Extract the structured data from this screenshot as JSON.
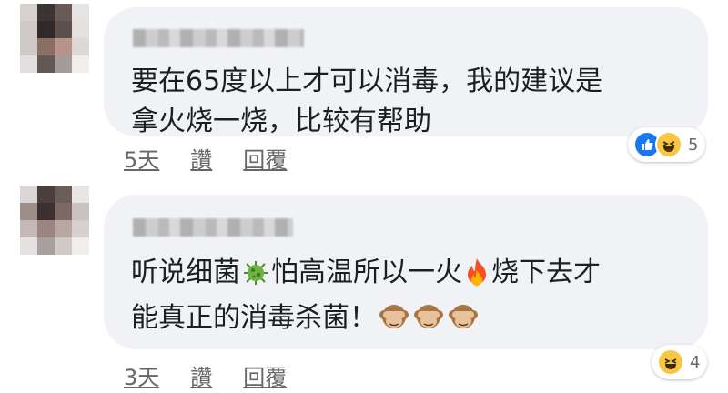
{
  "comments": [
    {
      "text": "要在65度以上才可以消毒，我的建议是\n拿火烧一烧，比较有帮助",
      "time": "5天",
      "like_label": "讚",
      "reply_label": "回覆",
      "reaction_icons": [
        "like-icon",
        "haha-icon"
      ],
      "reaction_count": "5"
    },
    {
      "text_parts": [
        "听说细菌",
        "怕高温所以一火",
        "烧下去才\n能真正的消毒杀菌！"
      ],
      "inline_emojis": [
        "microbe-emoji",
        "fire-emoji",
        "see-no-evil-monkey-emoji"
      ],
      "time": "3天",
      "like_label": "讚",
      "reply_label": "回覆",
      "reaction_icons": [
        "haha-icon"
      ],
      "reaction_count": "4"
    }
  ],
  "colors": {
    "bubble": "#f0f2f5",
    "text": "#1c1e21",
    "meta": "#65676b",
    "like": "#1877f2",
    "haha": "#f7c744"
  }
}
